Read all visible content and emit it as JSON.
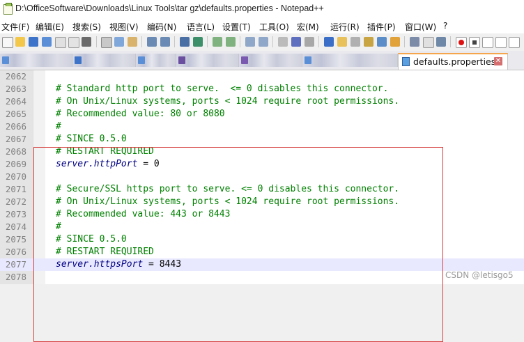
{
  "window": {
    "title": "D:\\OfficeSoftware\\Downloads\\Linux Tools\\tar gz\\defaults.properties - Notepad++"
  },
  "menu": [
    {
      "label": "文件(F)"
    },
    {
      "label": "编辑(E)"
    },
    {
      "label": "搜索(S)"
    },
    {
      "label": "视图(V)"
    },
    {
      "label": "编码(N)"
    },
    {
      "label": "语言(L)"
    },
    {
      "label": "设置(T)"
    },
    {
      "label": "工具(O)"
    },
    {
      "label": "宏(M)"
    },
    {
      "label": "运行(R)"
    },
    {
      "label": "插件(P)"
    },
    {
      "label": "窗口(W)"
    },
    {
      "label": "?"
    }
  ],
  "toolbar": {
    "icons": [
      "new-file-icon",
      "open-file-icon",
      "save-icon",
      "save-all-icon",
      "close-icon",
      "close-all-icon",
      "print-icon",
      "cut-icon",
      "copy-icon",
      "paste-icon",
      "undo-icon",
      "redo-icon",
      "find-icon",
      "replace-icon",
      "zoom-in-icon",
      "zoom-out-icon",
      "sync-vertical-icon",
      "sync-horizontal-icon",
      "word-wrap-icon",
      "show-all-chars-icon",
      "indent-guide-icon",
      "language-icon",
      "folder-icon",
      "doc-map-icon",
      "function-list-icon",
      "monitor-icon",
      "record-macro-icon",
      "stop-macro-icon",
      "play-macro-icon",
      "run-macro-icon",
      "save-macro-icon"
    ]
  },
  "tabs": {
    "active_label": "defaults.properties",
    "close_symbol": "✕"
  },
  "editor": {
    "current_line": "2077",
    "lines": [
      {
        "num": "2062",
        "text": ""
      },
      {
        "num": "2063",
        "text": "# Standard http port to serve.  <= 0 disables this connector."
      },
      {
        "num": "2064",
        "text": "# On Unix/Linux systems, ports < 1024 require root permissions."
      },
      {
        "num": "2065",
        "text": "# Recommended value: 80 or 8080"
      },
      {
        "num": "2066",
        "text": "#"
      },
      {
        "num": "2067",
        "text": "# SINCE 0.5.0"
      },
      {
        "num": "2068",
        "text": "# RESTART REQUIRED"
      },
      {
        "num": "2069",
        "key": "server.httpPort",
        "eq": " = ",
        "val": "0"
      },
      {
        "num": "2070",
        "text": ""
      },
      {
        "num": "2071",
        "text": "# Secure/SSL https port to serve. <= 0 disables this connector."
      },
      {
        "num": "2072",
        "text": "# On Unix/Linux systems, ports < 1024 require root permissions."
      },
      {
        "num": "2073",
        "text": "# Recommended value: 443 or 8443"
      },
      {
        "num": "2074",
        "text": "#"
      },
      {
        "num": "2075",
        "text": "# SINCE 0.5.0"
      },
      {
        "num": "2076",
        "text": "# RESTART REQUIRED"
      },
      {
        "num": "2077",
        "key": "server.httpsPort",
        "eq": " = ",
        "val": "8443"
      },
      {
        "num": "2078",
        "text": ""
      }
    ]
  },
  "watermark": "CSDN @letisgo5",
  "colors": {
    "comment": "#008000",
    "key": "#000080",
    "current_line_bg": "#e8e8ff",
    "annotation_box": "#d64040",
    "active_tab_accent": "#f5a54c"
  }
}
